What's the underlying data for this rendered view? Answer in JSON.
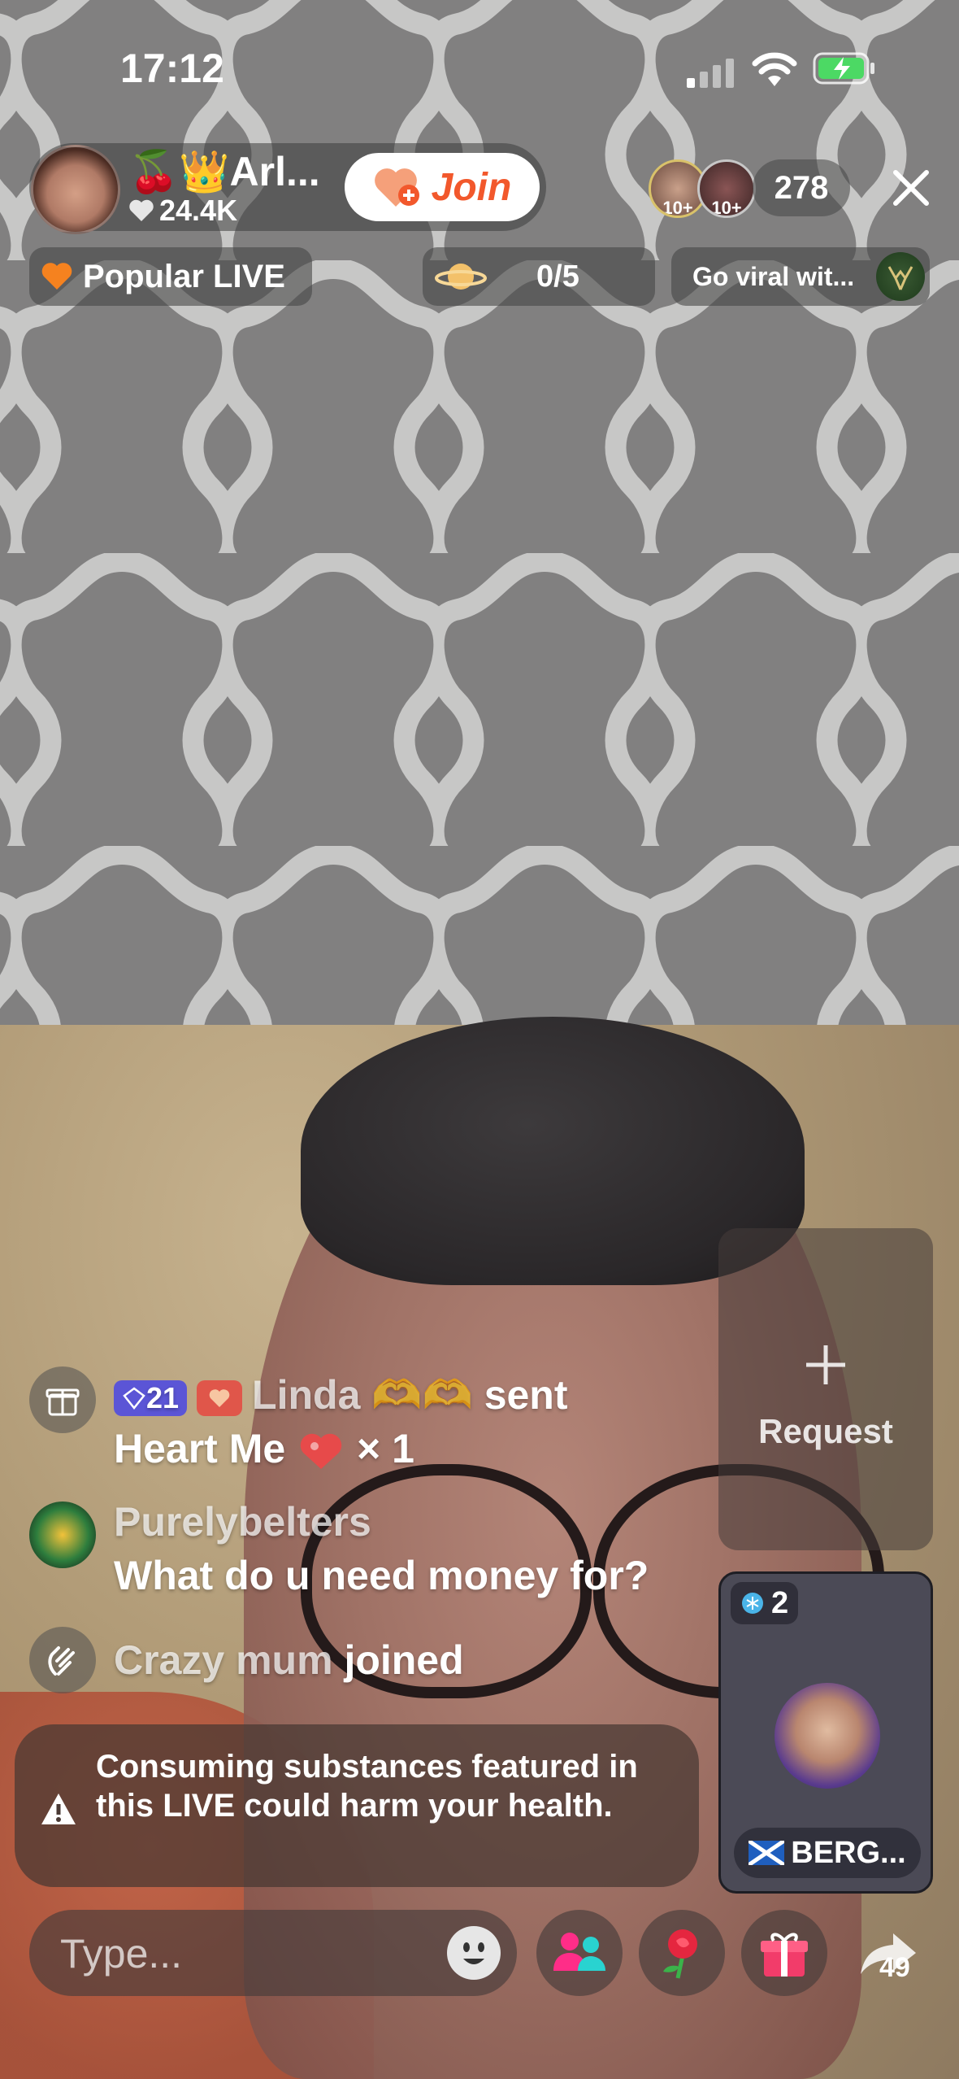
{
  "status_bar": {
    "time": "17:12"
  },
  "host": {
    "name": "🍒👑Arl...",
    "likes": "24.4K",
    "join_label": "Join"
  },
  "viewers": {
    "badges": [
      "10+",
      "10+"
    ],
    "count": "278"
  },
  "chips": {
    "popular": "Popular LIVE",
    "goal": "0/5",
    "viral": "Go viral wit..."
  },
  "comments": [
    {
      "badges": {
        "level": "21"
      },
      "user": "Linda 🫶🫶",
      "action": "sent",
      "gift": "Heart Me",
      "gift_count": "× 1",
      "icon": "gift-icon"
    },
    {
      "user": "Purelybelters",
      "text": "What do u need money for?",
      "icon": "avatar"
    },
    {
      "user": "Crazy mum",
      "action": "joined",
      "icon": "wave-icon"
    }
  ],
  "warning": {
    "text": "Consuming substances featured in this LIVE could harm your health."
  },
  "request": {
    "label": "Request"
  },
  "guest": {
    "badge": "2",
    "name": "BERG..."
  },
  "composer": {
    "placeholder": "Type..."
  },
  "share": {
    "count": "49"
  },
  "colors": {
    "join": "#f2582c",
    "gift_button": "#f23c6a",
    "viewers_button": "#ff2d88",
    "level_badge": "#5b55d6",
    "heart_badge": "#e0564a"
  }
}
